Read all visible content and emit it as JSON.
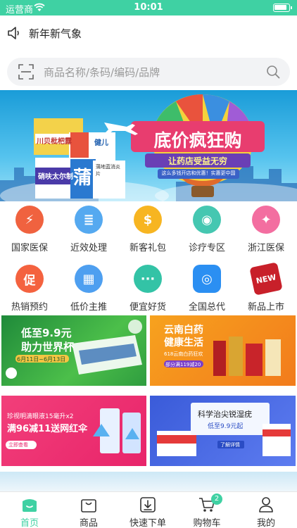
{
  "status_bar": {
    "carrier": "运营商",
    "time": "10:01"
  },
  "notice": {
    "text": "新年新气象"
  },
  "search": {
    "placeholder": "商品名称/条码/编码/品牌"
  },
  "banner": {
    "headline": "底价疯狂购",
    "subline": "让药店受益无穷",
    "tagline": "这么多钱开店和优惠！实惠更中国",
    "box_character": "蒲",
    "box_labels": [
      "川贝枇杷露",
      "硝呋太尔制",
      "健儿",
      "蒲地蓝消炎片"
    ]
  },
  "quick_icons": [
    {
      "label": "国家医保",
      "color": "#f0623f",
      "glyph": "⚡"
    },
    {
      "label": "近效处理",
      "color": "#55a9f0",
      "glyph": "≣"
    },
    {
      "label": "新客礼包",
      "color": "#f7b521",
      "glyph": "$"
    },
    {
      "label": "诊疗专区",
      "color": "#45c7b1",
      "glyph": "◉"
    },
    {
      "label": "浙江医保",
      "color": "#f36ea0",
      "glyph": "✦"
    },
    {
      "label": "热销预约",
      "color": "#f4623f",
      "glyph": "促"
    },
    {
      "label": "低价主推",
      "color": "#4e9ff0",
      "glyph": "▦"
    },
    {
      "label": "便宜好货",
      "color": "#33c3a6",
      "glyph": "···"
    },
    {
      "label": "全国总代",
      "color": "#2b8ff2",
      "glyph": "◎"
    },
    {
      "label": "新品上市",
      "color": "#c8202a",
      "glyph": "NEW"
    }
  ],
  "promos": {
    "worldcup": {
      "line1": "低至9.9元",
      "line2": "助力世界杯",
      "date": "6月11日~6月13日"
    },
    "yunnan": {
      "line1": "云南白药",
      "line2": "健康生活",
      "line3": "618云南白药狂欢",
      "tag": "部分满119减20"
    },
    "eyedrop": {
      "line1": "珍视明滴眼液15毫升x2",
      "line2": "满96减11送网红伞",
      "button": "立即查看"
    },
    "skin": {
      "line1": "科学治尖锐湿疣",
      "line2": "低至9.9元起",
      "button": "了解详情"
    }
  },
  "tab_bar": {
    "tabs": [
      {
        "label": "首页"
      },
      {
        "label": "商品"
      },
      {
        "label": "快速下单"
      },
      {
        "label": "购物车"
      },
      {
        "label": "我的"
      }
    ],
    "cart_count": "2"
  },
  "colors": {
    "accent": "#3fd1a3"
  }
}
